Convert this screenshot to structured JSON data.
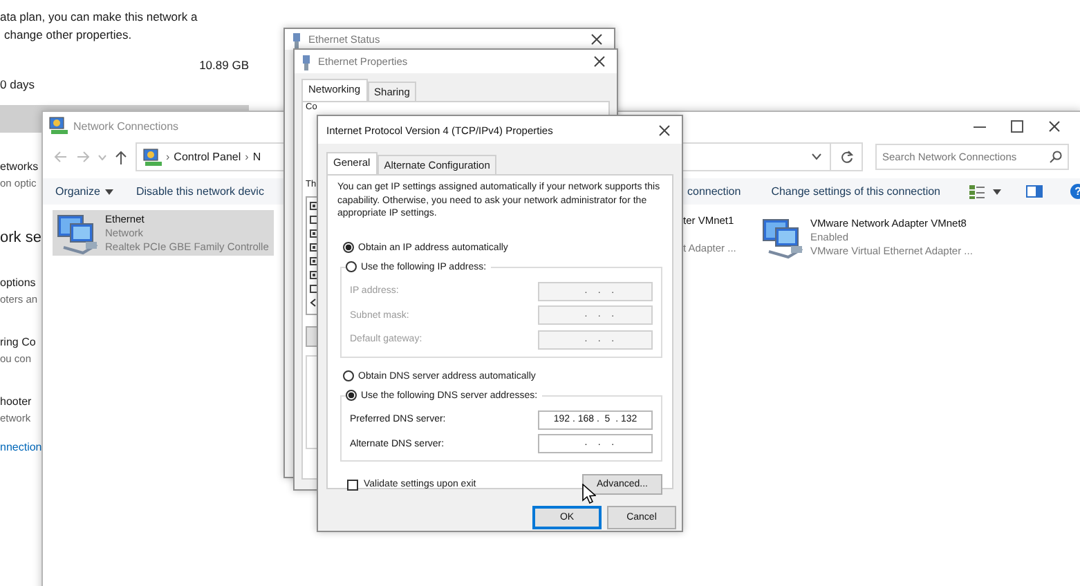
{
  "settings_page": {
    "text_lines": [
      "ata plan, you can make this network a",
      "change other properties."
    ],
    "data_used": "10.89 GB",
    "period": "0 days",
    "items": [
      {
        "kind": "option",
        "title": "etworks",
        "desc": "on optic"
      },
      {
        "kind": "heading",
        "title": "ork se"
      },
      {
        "kind": "option",
        "title": "options",
        "desc": "oters an"
      },
      {
        "kind": "option",
        "title": "ring Co",
        "desc": "ou con"
      },
      {
        "kind": "option",
        "title": "hooter",
        "desc": "etwork"
      },
      {
        "kind": "link",
        "title": "nnection"
      }
    ]
  },
  "network_connections": {
    "title": "Network Connections",
    "breadcrumb": [
      {
        "sep": "›",
        "label": "Control Panel"
      },
      {
        "sep": "›",
        "label": "N"
      }
    ],
    "search": {
      "placeholder": "Search Network Connections"
    },
    "toolbar_left": [
      {
        "label": "Organize",
        "menu": true
      },
      {
        "label": "Disable this network devic",
        "menu": false
      }
    ],
    "toolbar_right": [
      {
        "label": "connection"
      },
      {
        "label": "Change settings of this connection"
      }
    ],
    "help": "?",
    "items_left": [
      {
        "name": "Ethernet",
        "status": "Network",
        "device": "Realtek PCIe GBE Family Controlle",
        "selected": true
      }
    ],
    "partial_item": {
      "name": "ter VMnet1",
      "device": "t Adapter ..."
    },
    "items_right": [
      {
        "name": "VMware Network Adapter VMnet8",
        "status": "Enabled",
        "device": "VMware Virtual Ethernet Adapter ...",
        "selected": false
      }
    ]
  },
  "ethernet_status": {
    "title": "Ethernet Status"
  },
  "ethernet_properties": {
    "title": "Ethernet Properties",
    "tabs": [
      {
        "label": "Networking",
        "selected": true
      },
      {
        "label": "Sharing",
        "selected": false
      }
    ],
    "connect_label": "Co",
    "components_label": "Th",
    "components": [
      {
        "checked": true
      },
      {
        "checked": false
      },
      {
        "checked": true
      },
      {
        "checked": true
      },
      {
        "checked": true
      },
      {
        "checked": true
      },
      {
        "checked": false
      }
    ]
  },
  "ipv4": {
    "title": "Internet Protocol Version 4 (TCP/IPv4) Properties",
    "tabs": [
      {
        "label": "General",
        "selected": true
      },
      {
        "label": "Alternate Configuration",
        "selected": false
      }
    ],
    "intro": "You can get IP settings assigned automatically if your network supports this capability. Otherwise, you need to ask your network administrator for the appropriate IP settings.",
    "ip_options": [
      {
        "label": "Obtain an IP address automatically",
        "selected": true
      },
      {
        "label": "Use the following IP address:",
        "selected": false
      }
    ],
    "ip_fields": [
      {
        "label": "IP address:",
        "value": "   .    .    .",
        "disabled": true
      },
      {
        "label": "Subnet mask:",
        "value": "   .    .    .",
        "disabled": true
      },
      {
        "label": "Default gateway:",
        "value": "   .    .    .",
        "disabled": true
      }
    ],
    "dns_options": [
      {
        "label": "Obtain DNS server address automatically",
        "selected": false
      },
      {
        "label": "Use the following DNS server addresses:",
        "selected": true
      }
    ],
    "dns_fields": [
      {
        "label": "Preferred DNS server:",
        "value": "192 . 168 .  5  . 132",
        "disabled": false
      },
      {
        "label": "Alternate DNS server:",
        "value": "   .    .    .",
        "disabled": false
      }
    ],
    "validate": {
      "label": "Validate settings upon exit",
      "checked": false
    },
    "advanced": "Advanced...",
    "buttons": [
      {
        "label": "OK",
        "default": true
      },
      {
        "label": "Cancel",
        "default": false
      }
    ]
  }
}
